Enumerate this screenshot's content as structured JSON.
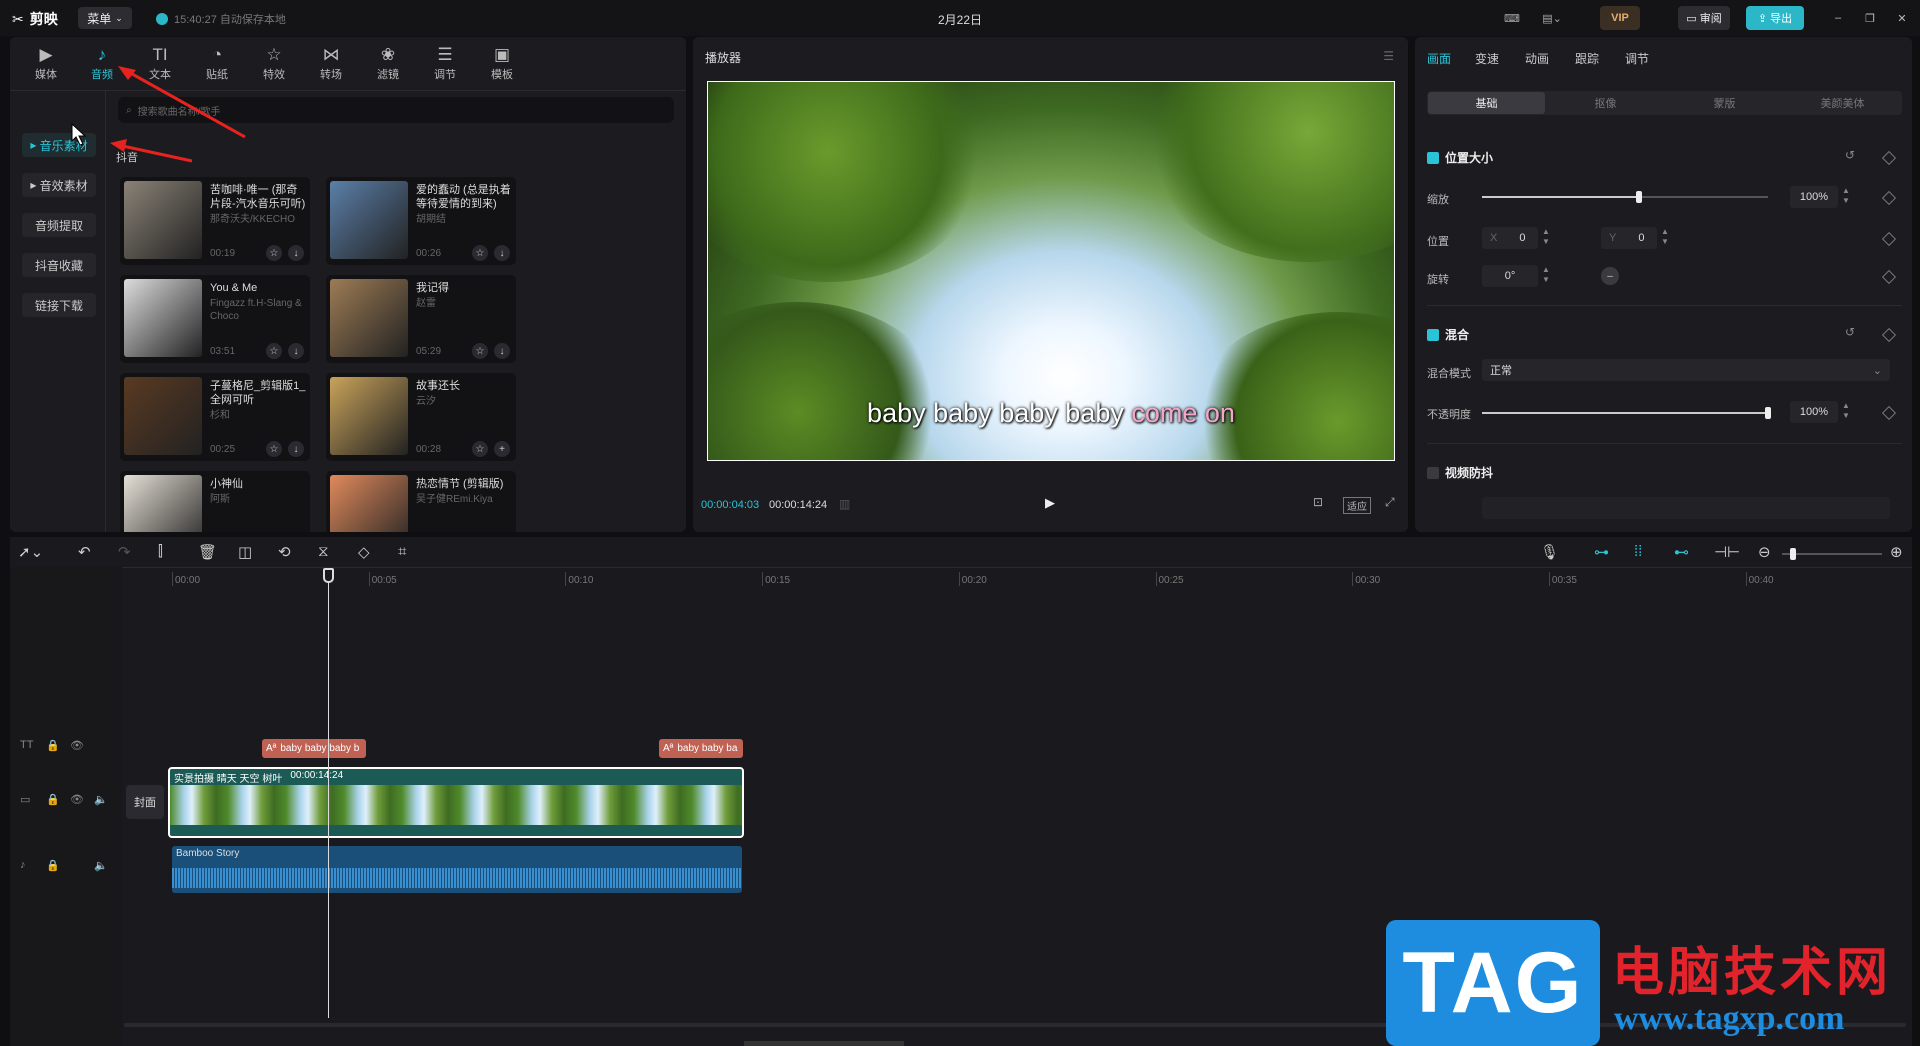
{
  "app": {
    "name": "剪映",
    "menu_label": "菜单",
    "autosave": "15:40:27 自动保存本地",
    "project_title": "2月22日",
    "vip": "VIP",
    "review": "审阅",
    "export": "导出"
  },
  "toolbar": {
    "items": [
      {
        "label": "媒体",
        "icon": "▶"
      },
      {
        "label": "音频",
        "icon": "♪"
      },
      {
        "label": "文本",
        "icon": "TI"
      },
      {
        "label": "贴纸",
        "icon": "◔"
      },
      {
        "label": "特效",
        "icon": "☆"
      },
      {
        "label": "转场",
        "icon": "⋈"
      },
      {
        "label": "滤镜",
        "icon": "❀"
      },
      {
        "label": "调节",
        "icon": "☰"
      },
      {
        "label": "模板",
        "icon": "▣"
      }
    ]
  },
  "sidebar": {
    "items": [
      "音乐素材",
      "音效素材",
      "音频提取",
      "抖音收藏",
      "链接下载"
    ]
  },
  "search": {
    "placeholder": "搜索歌曲名称/歌手"
  },
  "category": "抖音",
  "music": [
    {
      "title": "苦咖啡·唯一 (那奇片段-汽水音乐可听)",
      "artist": "那奇沃夫/KKECHO",
      "duration": "00:19",
      "action": "↓",
      "color": "#8a8276"
    },
    {
      "title": "爱的蠢动 (总是执着等待爱情的到来)",
      "artist": "胡期结",
      "duration": "00:26",
      "action": "↓",
      "color": "#5b7fa8"
    },
    {
      "title": "You & Me",
      "artist": "Fingazz ft.H-Slang & Choco",
      "duration": "03:51",
      "action": "↓",
      "color": "#dcdcdc"
    },
    {
      "title": "我记得",
      "artist": "赵雷",
      "duration": "05:29",
      "action": "↓",
      "color": "#9d7c55"
    },
    {
      "title": "子蔓格尼_剪辑版1_全网可听",
      "artist": "杉和",
      "duration": "00:25",
      "action": "↓",
      "color": "#5a3a22"
    },
    {
      "title": "故事还长",
      "artist": "云汐",
      "duration": "00:28",
      "action": "+",
      "color": "#c9a35a"
    },
    {
      "title": "小神仙",
      "artist": "阿斯",
      "duration": "",
      "action": "",
      "color": "#e6e0d6"
    },
    {
      "title": "热恋情节 (剪辑版)",
      "artist": "吴子健REmi.Kiya",
      "duration": "",
      "action": "",
      "color": "#e08a5c"
    }
  ],
  "player": {
    "title": "播放器",
    "subtitle_words": [
      "baby",
      "baby",
      "baby",
      "baby"
    ],
    "subtitle_highlight": [
      "come",
      "on"
    ],
    "current_time": "00:00:04:03",
    "total_time": "00:00:14:24",
    "ratio_label": "适应"
  },
  "right_panel": {
    "tabs": [
      "画面",
      "变速",
      "动画",
      "跟踪",
      "调节"
    ],
    "segments": [
      "基础",
      "抠像",
      "蒙版",
      "美颜美体"
    ],
    "position_size": {
      "title": "位置大小",
      "scale_label": "缩放",
      "scale_value": "100%",
      "scale_fraction": 0.55,
      "pos_label": "位置",
      "x_label": "X",
      "x": "0",
      "y_label": "Y",
      "y": "0",
      "rot_label": "旋转",
      "rot": "0°"
    },
    "blend": {
      "title": "混合",
      "mode_label": "混合模式",
      "mode": "正常",
      "opacity_label": "不透明度",
      "opacity": "100%",
      "opacity_fraction": 1.0
    },
    "stabilize": {
      "title": "视频防抖"
    }
  },
  "timeline": {
    "ticks": [
      "00:00",
      "00:05",
      "00:10",
      "00:15",
      "00:20",
      "00:25",
      "00:30",
      "00:35",
      "00:40"
    ],
    "text_clips": [
      "baby baby baby b",
      "baby baby ba"
    ],
    "video_clip": {
      "name": "实景拍摄 晴天 天空 树叶",
      "duration": "00:00:14:24"
    },
    "cover_label": "封面",
    "audio_clip": {
      "name": "Bamboo Story"
    }
  },
  "watermark": {
    "brand": "TAG",
    "site_name": "电脑技术网",
    "url": "www.tagxp.com"
  }
}
